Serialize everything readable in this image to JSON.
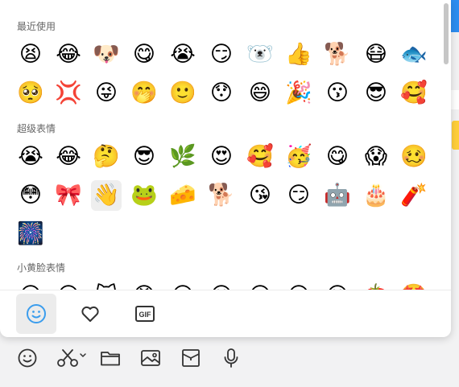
{
  "panel": {
    "sections": [
      {
        "title": "最近使用",
        "rows": [
          [
            "😫",
            "😂",
            "🐶",
            "😋",
            "😭",
            "😏",
            "🐻‍❄️",
            "👍",
            "🐕",
            "😷",
            "🐟"
          ],
          [
            "🥺",
            "💢",
            "😜",
            "🤭",
            "🙂",
            "😯",
            "😄",
            "🎉",
            "😗",
            "😎",
            "🥰"
          ]
        ]
      },
      {
        "title": "超级表情",
        "rows": [
          [
            "😭",
            "😂",
            "🤔",
            "😎",
            "🌿",
            "😍",
            "🥰",
            "🥳",
            "😋",
            "😱",
            "🥴"
          ],
          [
            "😳",
            "🎀",
            "👋",
            "🐸",
            "🧀",
            "🐕",
            "😘",
            "😏",
            "🤖",
            "🎂",
            "🧨"
          ],
          [
            "🎆"
          ]
        ]
      },
      {
        "title": "小黄脸表情",
        "rows": [
          [
            "😀",
            "😀",
            "🐱",
            "😡",
            "😐",
            "😊",
            "😀",
            "😐",
            "😊",
            "🍅",
            "🤩"
          ]
        ]
      }
    ],
    "tabs": [
      {
        "name": "smiley-icon",
        "active": true
      },
      {
        "name": "heart-icon",
        "active": false
      },
      {
        "name": "gif-icon",
        "active": false,
        "label": "GIF"
      }
    ]
  },
  "colors": {
    "accent": "#3b9ded",
    "icon": "#333333"
  },
  "toolbar": {
    "items": [
      "emoji-icon",
      "scissors-icon",
      "folder-icon",
      "image-icon",
      "box-icon",
      "microphone-icon"
    ]
  }
}
